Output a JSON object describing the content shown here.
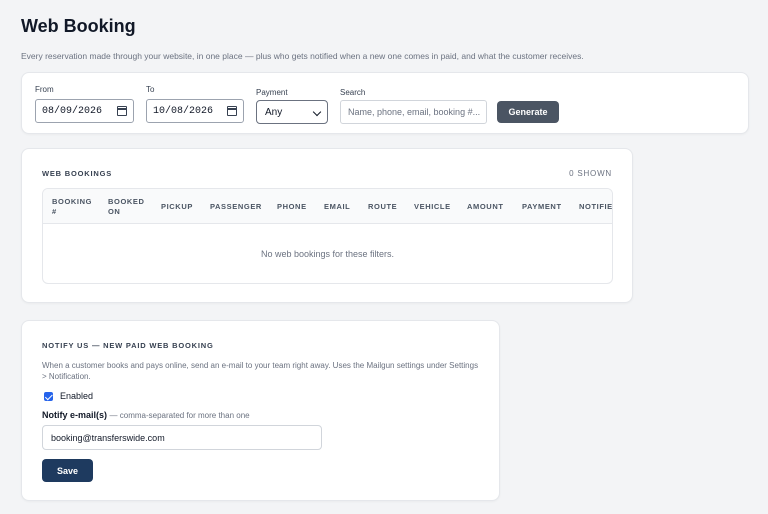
{
  "page": {
    "title": "Web Booking",
    "subtitle": "Every reservation made through your website, in one place — plus who gets notified when a new one comes in paid, and what the customer receives."
  },
  "filters": {
    "from_label": "From",
    "from_value": "08/09/2026",
    "to_label": "To",
    "to_value": "10/08/2026",
    "payment_label": "Payment",
    "payment_value": "Any",
    "search_label": "Search",
    "search_placeholder": "Name, phone, email, booking #...",
    "generate_label": "Generate"
  },
  "bookings": {
    "title": "Web Bookings",
    "shown": "0 shown",
    "columns": [
      "Booking #",
      "Booked on",
      "Pickup",
      "Passenger",
      "Phone",
      "Email",
      "Route",
      "Vehicle",
      "Amount",
      "Payment",
      "Notified"
    ],
    "empty_message": "No web bookings for these filters."
  },
  "notify": {
    "title": "Notify us — new paid web booking",
    "description": "When a customer books and pays online, send an e-mail to your team right away. Uses the Mailgun settings under Settings > Notification.",
    "enabled_label": "Enabled",
    "enabled": true,
    "email_label": "Notify e-mail(s)",
    "email_hint": "— comma-separated for more than one",
    "email_value": "booking@transferswide.com",
    "save_label": "Save"
  },
  "colors": {
    "background": "#f3f4f6",
    "generate_button": "#4b5563",
    "save_button": "#1e3a5f",
    "checkbox": "#2563eb"
  }
}
